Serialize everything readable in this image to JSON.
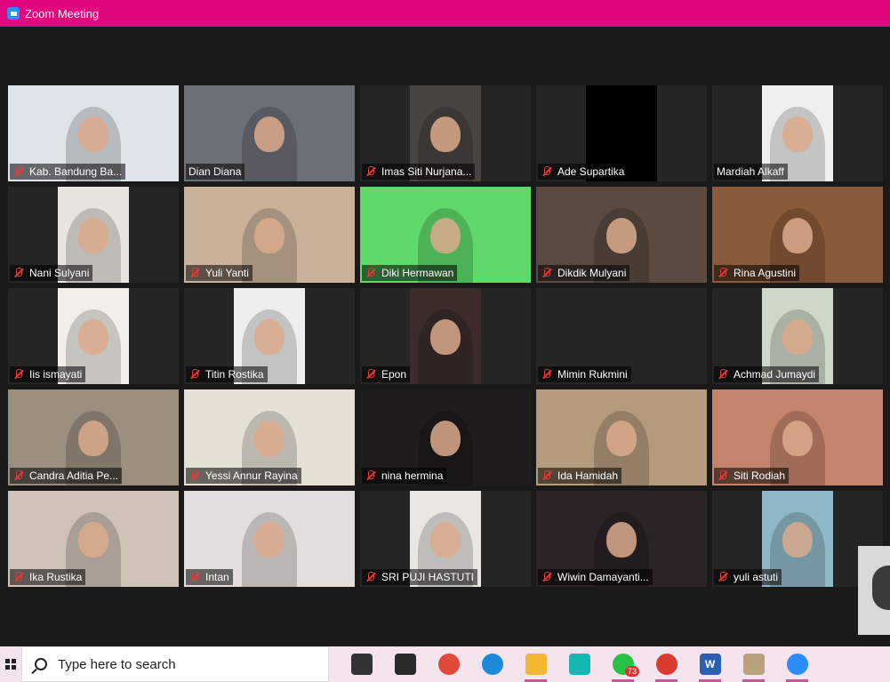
{
  "window": {
    "title": "Zoom Meeting"
  },
  "colors": {
    "titlebar": "#e0077f",
    "active_speaker_border": "#d6e85c",
    "muted_mic": "#e23b3b"
  },
  "participants": [
    {
      "name": "Kab. Bandung Ba...",
      "muted": true,
      "video": "slide",
      "bg": "#dfe4ea"
    },
    {
      "name": "Dian Diana",
      "muted": false,
      "video": "outdoor",
      "bg": "#6b6f77",
      "active": true
    },
    {
      "name": "Imas Siti Nurjana...",
      "muted": true,
      "video": "narrow",
      "bg": "#4a4440"
    },
    {
      "name": "Ade Supartika",
      "muted": true,
      "video": "black",
      "bg": "#000000"
    },
    {
      "name": "Mardiah Alkaff",
      "muted": false,
      "video": "narrow",
      "bg": "#efefef"
    },
    {
      "name": "Nani Sulyani",
      "muted": true,
      "video": "narrow",
      "bg": "#e8e4e0"
    },
    {
      "name": "Yuli Yanti",
      "muted": true,
      "video": "room",
      "bg": "#c9b29a"
    },
    {
      "name": "Diki Hermawan",
      "muted": true,
      "video": "green",
      "bg": "#5fd96a"
    },
    {
      "name": "Dikdik Mulyani",
      "muted": true,
      "video": "dark",
      "bg": "#5a4a40"
    },
    {
      "name": "Rina Agustini",
      "muted": true,
      "video": "room",
      "bg": "#8a5b3a"
    },
    {
      "name": "Iis ismayati",
      "muted": true,
      "video": "narrow",
      "bg": "#f2efea"
    },
    {
      "name": "Titin Rostika",
      "muted": true,
      "video": "narrow",
      "bg": "#eeeeee"
    },
    {
      "name": "Epon",
      "muted": true,
      "video": "narrow",
      "bg": "#3b2c2a"
    },
    {
      "name": "Mimin Rukmini",
      "muted": true,
      "video": "none",
      "bg": "#252525"
    },
    {
      "name": "Achmad Jumaydi",
      "muted": true,
      "video": "narrow",
      "bg": "#cfd8c8"
    },
    {
      "name": "Candra Aditia Pe...",
      "muted": true,
      "video": "room",
      "bg": "#9b8f80"
    },
    {
      "name": "Yessi Annur Rayina",
      "muted": true,
      "video": "room",
      "bg": "#e6e0d6"
    },
    {
      "name": "nina hermina",
      "muted": true,
      "video": "dark",
      "bg": "#1e1c1c"
    },
    {
      "name": "Ida Hamidah",
      "muted": true,
      "video": "room",
      "bg": "#b59a7c"
    },
    {
      "name": "Siti Rodiah",
      "muted": true,
      "video": "room",
      "bg": "#c4836b"
    },
    {
      "name": "Ika Rustika",
      "muted": true,
      "video": "room",
      "bg": "#cfc3b8"
    },
    {
      "name": "Intan",
      "muted": true,
      "video": "room",
      "bg": "#e3dedb"
    },
    {
      "name": "SRI PUJI HASTUTI",
      "muted": true,
      "video": "narrow",
      "bg": "#e9e7e2"
    },
    {
      "name": "Wiwin Damayanti...",
      "muted": true,
      "video": "dark",
      "bg": "#2b2325"
    },
    {
      "name": "yuli astuti",
      "muted": true,
      "video": "narrow",
      "bg": "#8fb8c7"
    }
  ],
  "taskbar": {
    "search_placeholder": "Type here to search",
    "apps": [
      {
        "icon": "task-view-icon",
        "color": "#333333",
        "glyph": "",
        "running": false
      },
      {
        "icon": "film-icon",
        "color": "#2a2a2a",
        "glyph": "",
        "running": false
      },
      {
        "icon": "camera-app-icon",
        "color": "#e14a3b",
        "glyph": "",
        "running": false
      },
      {
        "icon": "edge-icon",
        "color": "#1b8ad8",
        "glyph": "",
        "running": false
      },
      {
        "icon": "file-explorer-icon",
        "color": "#f2b733",
        "glyph": "",
        "running": true
      },
      {
        "icon": "tiktok-icon",
        "color": "#14b8b0",
        "glyph": "",
        "running": false
      },
      {
        "icon": "whatsapp-icon",
        "color": "#25c246",
        "glyph": "",
        "running": true,
        "badge": "73"
      },
      {
        "icon": "chrome-icon",
        "color": "#d93b30",
        "glyph": "",
        "running": true
      },
      {
        "icon": "word-icon",
        "color": "#2b5fb3",
        "glyph": "W",
        "running": true
      },
      {
        "icon": "paint-icon",
        "color": "#b7a27e",
        "glyph": "",
        "running": true
      },
      {
        "icon": "zoom-icon",
        "color": "#2d8cff",
        "glyph": "",
        "running": true
      }
    ]
  }
}
